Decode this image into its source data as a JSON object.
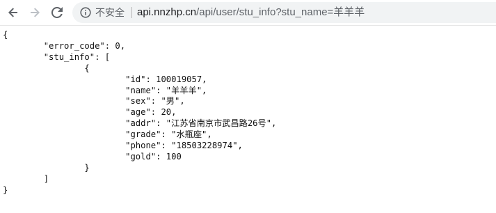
{
  "browser": {
    "security_label": "不安全",
    "url_host": "api.nnzhp.cn",
    "url_path": "/api/user/stu_info?stu_name=羊羊羊",
    "icons": {
      "back": "back-arrow-icon",
      "forward": "forward-arrow-icon",
      "reload": "reload-icon",
      "info": "info-icon"
    }
  },
  "json_response": {
    "error_code": 0,
    "stu_info": [
      {
        "id": 100019057,
        "name": "羊羊羊",
        "sex": "男",
        "age": 20,
        "addr": "江苏省南京市武昌路26号",
        "grade": "水瓶座",
        "phone": "18503228974",
        "gold": 100
      }
    ]
  }
}
